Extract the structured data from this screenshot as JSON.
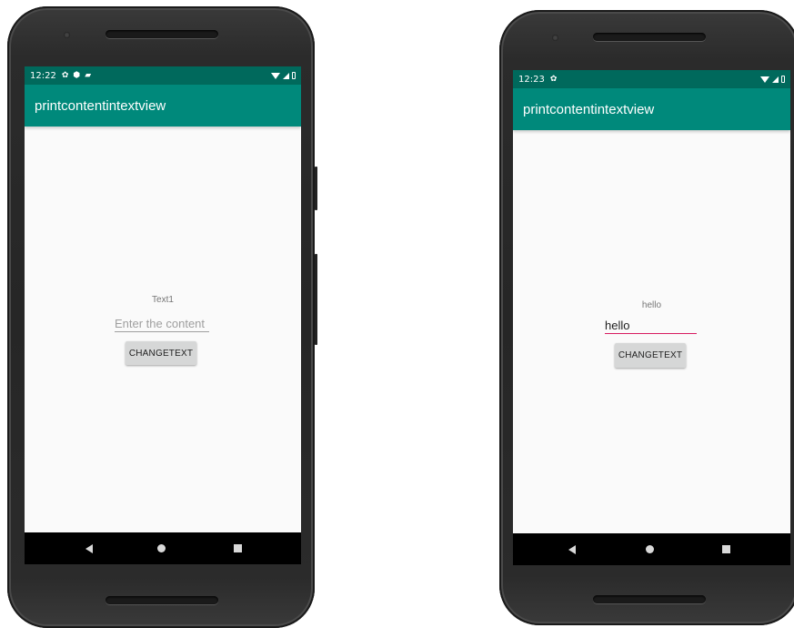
{
  "screens": [
    {
      "status_time": "12:22",
      "status_icons": [
        "settings-icon",
        "shield-icon",
        "sd-card-icon"
      ],
      "app_title": "printcontentintextview",
      "display_text": "Text1",
      "edit": {
        "value": "",
        "placeholder": "Enter the content"
      },
      "button_label": "CHANGETEXT"
    },
    {
      "status_time": "12:23",
      "status_icons": [
        "settings-icon"
      ],
      "app_title": "printcontentintextview",
      "display_text": "hello",
      "edit": {
        "value": "hello",
        "placeholder": "Enter the content"
      },
      "button_label": "CHANGETEXT"
    }
  ],
  "colors": {
    "status_bar": "#00695c",
    "app_bar": "#00897b",
    "accent": "#d81b60",
    "screen_bg": "#fafafa",
    "nav_bar": "#000000"
  },
  "nav_icons": [
    "back-icon",
    "home-icon",
    "recents-icon"
  ]
}
